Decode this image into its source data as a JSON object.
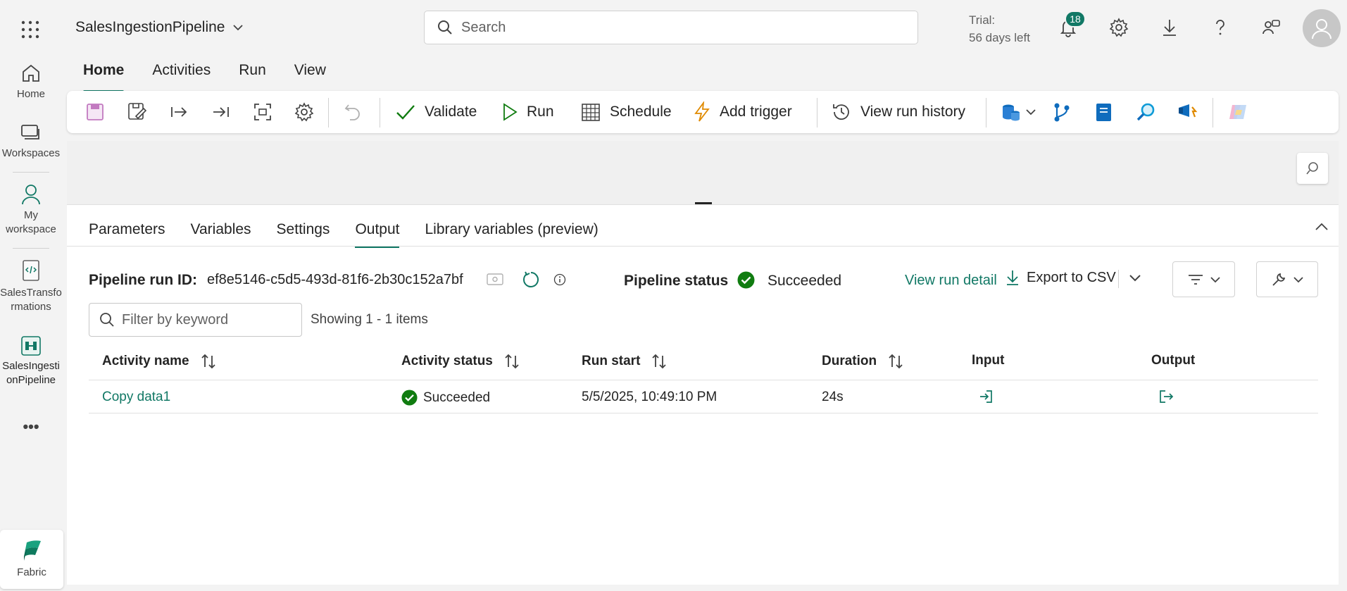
{
  "header": {
    "pipeline_name": "SalesIngestionPipeline",
    "search_placeholder": "Search",
    "trial_line1": "Trial:",
    "trial_line2": "56 days left",
    "notification_count": "18"
  },
  "rail": {
    "items": [
      {
        "label": "Home",
        "icon": "home-icon"
      },
      {
        "label": "Workspaces",
        "icon": "workspaces-icon"
      },
      {
        "label_line1": "My",
        "label_line2": "workspace",
        "icon": "person-icon"
      },
      {
        "label_line1": "SalesTransfo",
        "label_line2": "rmations",
        "icon": "notebook-icon"
      },
      {
        "label_line1": "SalesIngesti",
        "label_line2": "onPipeline",
        "icon": "pipeline-icon"
      }
    ],
    "more": "•••",
    "fabric_label": "Fabric"
  },
  "menu": {
    "tabs": [
      "Home",
      "Activities",
      "Run",
      "View"
    ],
    "active": "Home"
  },
  "toolbar": {
    "validate": "Validate",
    "run": "Run",
    "schedule": "Schedule",
    "add_trigger": "Add trigger",
    "view_run_history": "View run history"
  },
  "panel": {
    "tabs": [
      "Parameters",
      "Variables",
      "Settings",
      "Output",
      "Library variables (preview)"
    ],
    "active_tab": "Output",
    "run_id_label": "Pipeline run ID:",
    "run_id": "ef8e5146-c5d5-493d-81f6-2b30c152a7bf",
    "status_label": "Pipeline status",
    "status": "Succeeded",
    "view_run_detail": "View run detail",
    "export_csv": "Export to CSV",
    "filter_placeholder": "Filter by keyword",
    "showing": "Showing 1 - 1 items"
  },
  "table": {
    "columns": [
      "Activity name",
      "Activity status",
      "Run start",
      "Duration",
      "Input",
      "Output"
    ],
    "rows": [
      {
        "activity_name": "Copy data1",
        "status": "Succeeded",
        "run_start": "5/5/2025, 10:49:10 PM",
        "duration": "24s"
      }
    ]
  },
  "colors": {
    "accent": "#117865",
    "success": "#107c10",
    "background": "#f3f3f3"
  }
}
